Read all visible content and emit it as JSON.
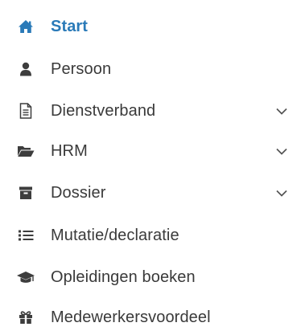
{
  "colors": {
    "active": "#2a7ab8",
    "text": "#3a3a3a",
    "icon": "#3d3d3d",
    "chevron": "#555555"
  },
  "menu": {
    "items": [
      {
        "label": "Start",
        "icon": "home-icon",
        "active": true,
        "expandable": false
      },
      {
        "label": "Persoon",
        "icon": "user-icon",
        "active": false,
        "expandable": false
      },
      {
        "label": "Dienstverband",
        "icon": "document-icon",
        "active": false,
        "expandable": true
      },
      {
        "label": "HRM",
        "icon": "folder-open-icon",
        "active": false,
        "expandable": true
      },
      {
        "label": "Dossier",
        "icon": "archive-icon",
        "active": false,
        "expandable": true
      },
      {
        "label": "Mutatie/declaratie",
        "icon": "list-icon",
        "active": false,
        "expandable": false
      },
      {
        "label": "Opleidingen boeken",
        "icon": "graduation-cap-icon",
        "active": false,
        "expandable": false
      },
      {
        "label": "Medewerkersvoordeel",
        "icon": "gift-icon",
        "active": false,
        "expandable": false
      }
    ]
  }
}
